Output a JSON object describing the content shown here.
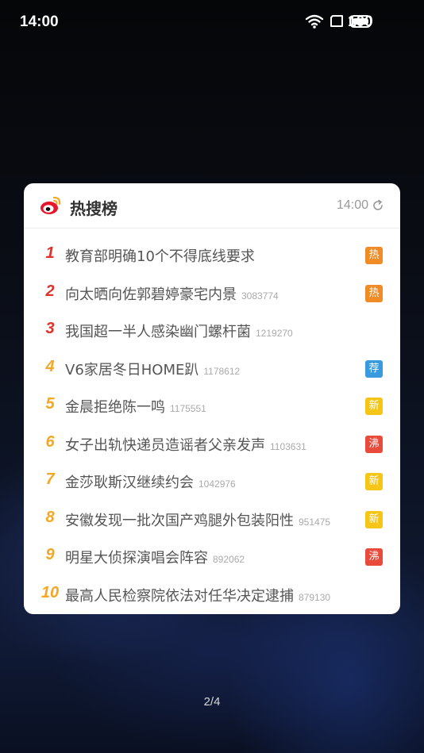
{
  "status_bar": {
    "time": "14:00",
    "battery": "100",
    "icons": [
      "wifi-icon",
      "screen-icon",
      "battery-icon"
    ]
  },
  "widget": {
    "title": "热搜榜",
    "time": "14:00",
    "refresh_icon": "refresh-icon",
    "logo": "weibo-logo-icon"
  },
  "colors": {
    "rank_top": "#e0312a",
    "rank_other": "#f5a623",
    "badge_hot": "#f08c28",
    "badge_recommend": "#3a9ae0",
    "badge_new": "#f5c518",
    "badge_boil": "#e84a3c"
  },
  "items": [
    {
      "rank": "1",
      "title": "教育部明确10个不得底线要求",
      "count": "",
      "badge": "热",
      "badge_type": "hot"
    },
    {
      "rank": "2",
      "title": "向太晒向佐郭碧婷豪宅内景",
      "count": "3083774",
      "badge": "热",
      "badge_type": "hot"
    },
    {
      "rank": "3",
      "title": "我国超一半人感染幽门螺杆菌",
      "count": "1219270",
      "badge": "",
      "badge_type": ""
    },
    {
      "rank": "4",
      "title": "V6家居冬日HOME趴",
      "count": "1178612",
      "badge": "荐",
      "badge_type": "recommend"
    },
    {
      "rank": "5",
      "title": "金晨拒绝陈一鸣",
      "count": "1175551",
      "badge": "新",
      "badge_type": "new"
    },
    {
      "rank": "6",
      "title": "女子出轨快递员造谣者父亲发声",
      "count": "1103631",
      "badge": "沸",
      "badge_type": "boil"
    },
    {
      "rank": "7",
      "title": "金莎耿斯汉继续约会",
      "count": "1042976",
      "badge": "新",
      "badge_type": "new"
    },
    {
      "rank": "8",
      "title": "安徽发现一批次国产鸡腿外包装阳性",
      "count": "951475",
      "badge": "新",
      "badge_type": "new"
    },
    {
      "rank": "9",
      "title": "明星大侦探演唱会阵容",
      "count": "892062",
      "badge": "沸",
      "badge_type": "boil"
    },
    {
      "rank": "10",
      "title": "最高人民检察院依法对任华决定逮捕",
      "count": "879130",
      "badge": "",
      "badge_type": ""
    }
  ],
  "page_indicator": "2/4"
}
